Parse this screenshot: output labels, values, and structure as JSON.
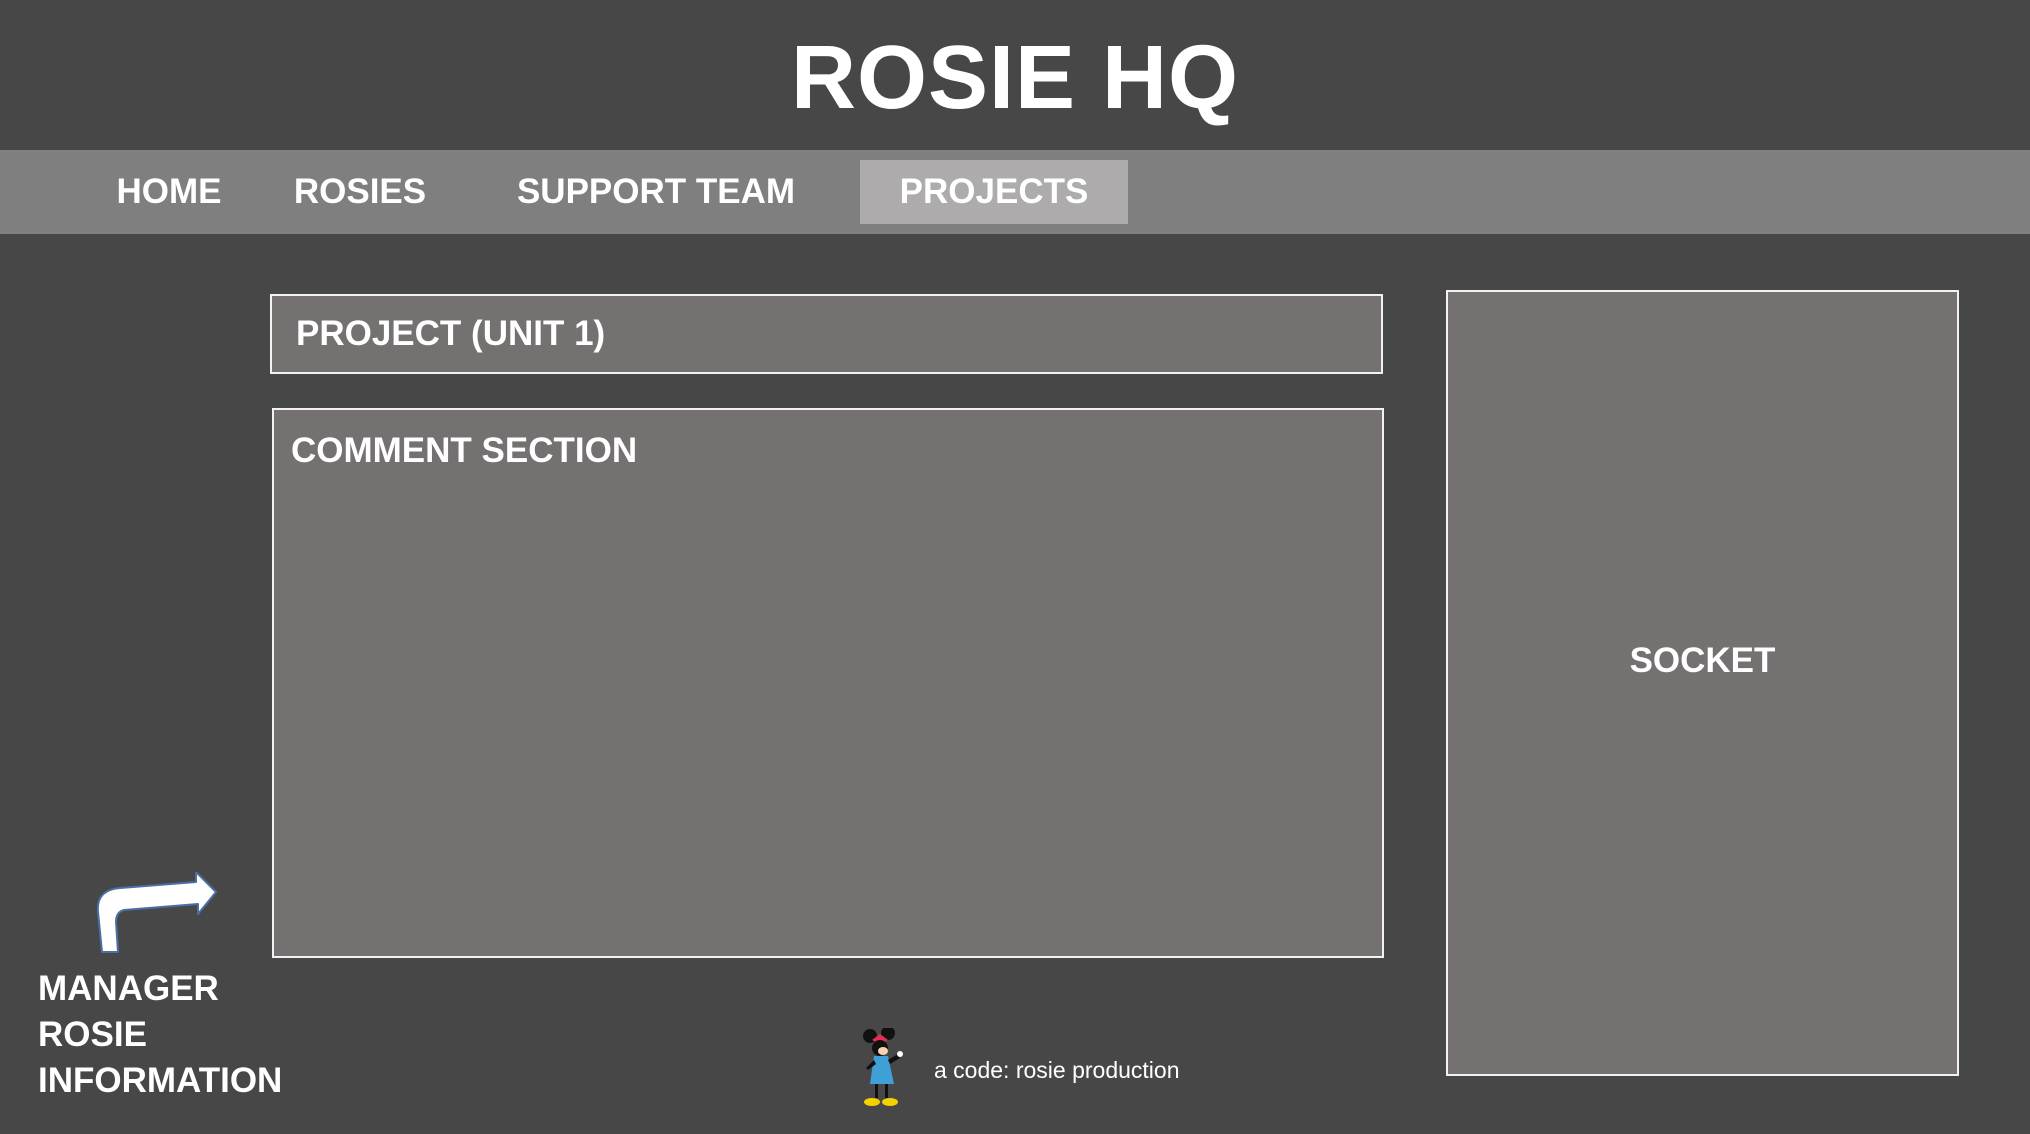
{
  "header": {
    "title": "ROSIE HQ"
  },
  "nav": {
    "items": [
      {
        "label": "HOME",
        "active": false
      },
      {
        "label": "ROSIES",
        "active": false
      },
      {
        "label": "SUPPORT TEAM",
        "active": false
      },
      {
        "label": "PROJECTS",
        "active": true
      }
    ]
  },
  "main": {
    "project_title": "PROJECT (UNIT 1)",
    "comment_title": "COMMENT SECTION"
  },
  "sidebar": {
    "socket_label": "SOCKET"
  },
  "manager": {
    "lines": [
      "MANAGER",
      "ROSIE",
      "INFORMATION"
    ],
    "icon": "curved-arrow-icon"
  },
  "footer": {
    "text": "a code: rosie production",
    "icon": "minnie-mouse-mascot-icon"
  },
  "colors": {
    "background": "#484748",
    "nav_bar": "#7f7f7f",
    "nav_active": "#adabab",
    "panel": "#747170",
    "panel_border": "#f2f2f2",
    "text": "#ffffff"
  }
}
